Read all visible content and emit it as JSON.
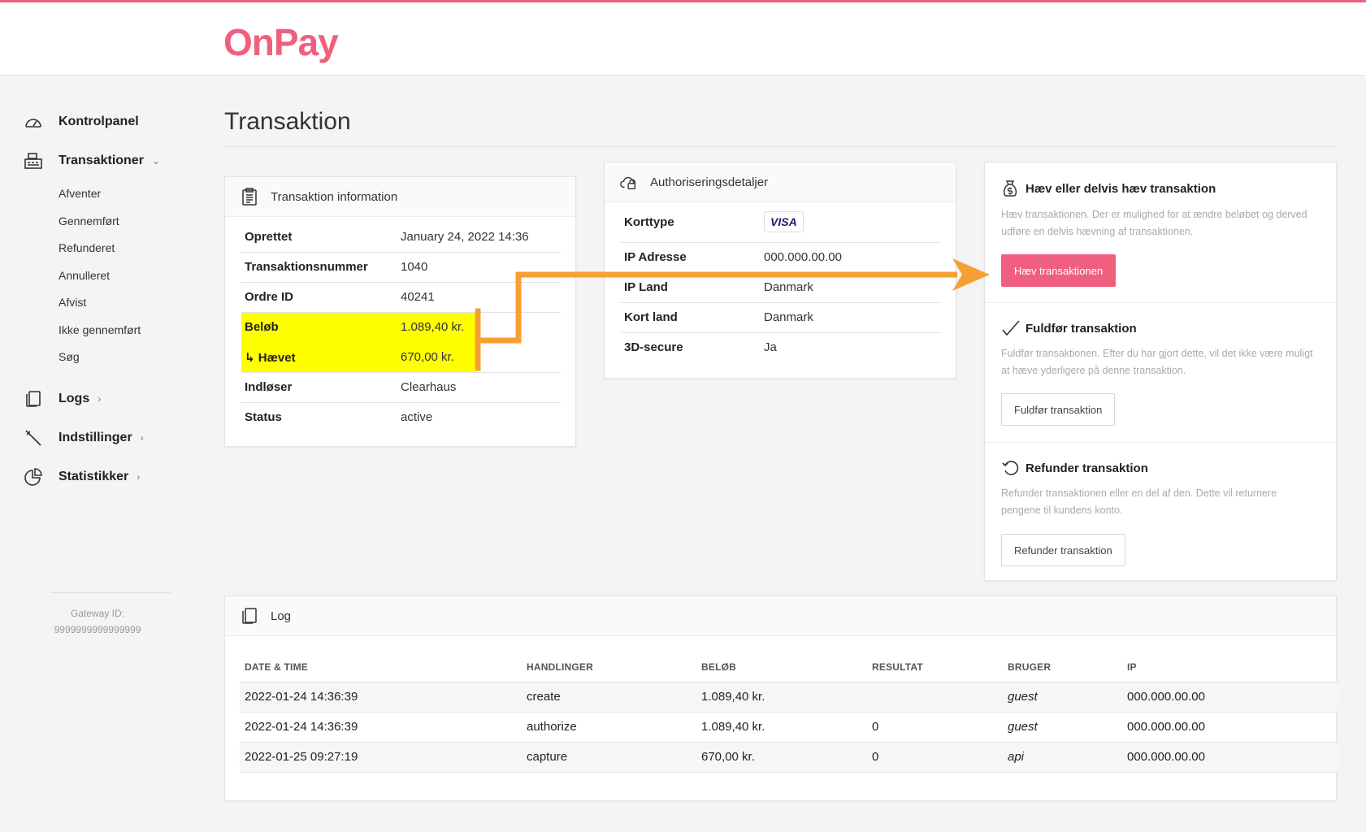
{
  "brand": {
    "logo": "OnPay",
    "accent": "#f0607e"
  },
  "sidebar": {
    "main_items": [
      {
        "label": "Kontrolpanel",
        "icon": "gauge-icon"
      },
      {
        "label": "Transaktioner",
        "icon": "register-icon"
      },
      {
        "label": "Logs",
        "icon": "documents-icon"
      },
      {
        "label": "Indstillinger",
        "icon": "wrench-icon"
      },
      {
        "label": "Statistikker",
        "icon": "pie-chart-icon"
      }
    ],
    "sub_items": [
      "Afventer",
      "Gennemført",
      "Refunderet",
      "Annulleret",
      "Afvist",
      "Ikke gennemført",
      "Søg"
    ],
    "gateway_label": "Gateway ID:",
    "gateway_id": "9999999999999999"
  },
  "page": {
    "title": "Transaktion"
  },
  "info_card": {
    "title": "Transaktion information",
    "rows": [
      {
        "key": "Oprettet",
        "value": "January 24, 2022 14:36"
      },
      {
        "key": "Transaktionsnummer",
        "value": "1040"
      },
      {
        "key": "Ordre ID",
        "value": "40241"
      },
      {
        "key": "Beløb",
        "value": "1.089,40 kr."
      },
      {
        "key": "↳ Hævet",
        "value": "670,00 kr."
      },
      {
        "key": "Indløser",
        "value": "Clearhaus"
      },
      {
        "key": "Status",
        "value": "active"
      }
    ]
  },
  "auth_card": {
    "title": "Authoriseringsdetaljer",
    "rows": [
      {
        "key": "Korttype",
        "value": "VISA"
      },
      {
        "key": "IP Adresse",
        "value": "000.000.00.00"
      },
      {
        "key": "IP Land",
        "value": "Danmark"
      },
      {
        "key": "Kort land",
        "value": "Danmark"
      },
      {
        "key": "3D-secure",
        "value": "Ja"
      }
    ]
  },
  "actions": {
    "capture": {
      "title": "Hæv eller delvis hæv transaktion",
      "desc": "Hæv transaktionen. Der er mulighed for at ændre beløbet og derved udføre en delvis hævning af transaktionen.",
      "button": "Hæv transaktionen"
    },
    "complete": {
      "title": "Fuldfør transaktion",
      "desc": "Fuldfør transaktionen. Efter du har gjort dette, vil det ikke være muligt at hæve yderligere på denne transaktion.",
      "button": "Fuldfør transaktion"
    },
    "refund": {
      "title": "Refunder transaktion",
      "desc": "Refunder transaktionen eller en del af den. Dette vil returnere pengene til kundens konto.",
      "button": "Refunder transaktion"
    }
  },
  "log": {
    "title": "Log",
    "headers": [
      "DATE & TIME",
      "HANDLINGER",
      "BELØB",
      "RESULTAT",
      "BRUGER",
      "IP"
    ],
    "rows": [
      [
        "2022-01-24 14:36:39",
        "create",
        "1.089,40 kr.",
        "",
        "guest",
        "000.000.00.00"
      ],
      [
        "2022-01-24 14:36:39",
        "authorize",
        "1.089,40 kr.",
        "0",
        "guest",
        "000.000.00.00"
      ],
      [
        "2022-01-25 09:27:19",
        "capture",
        "670,00 kr.",
        "0",
        "api",
        "000.000.00.00"
      ]
    ]
  },
  "colors": {
    "highlight": "#ffff00",
    "arrow": "#f5a033",
    "link": "#f0607e"
  }
}
